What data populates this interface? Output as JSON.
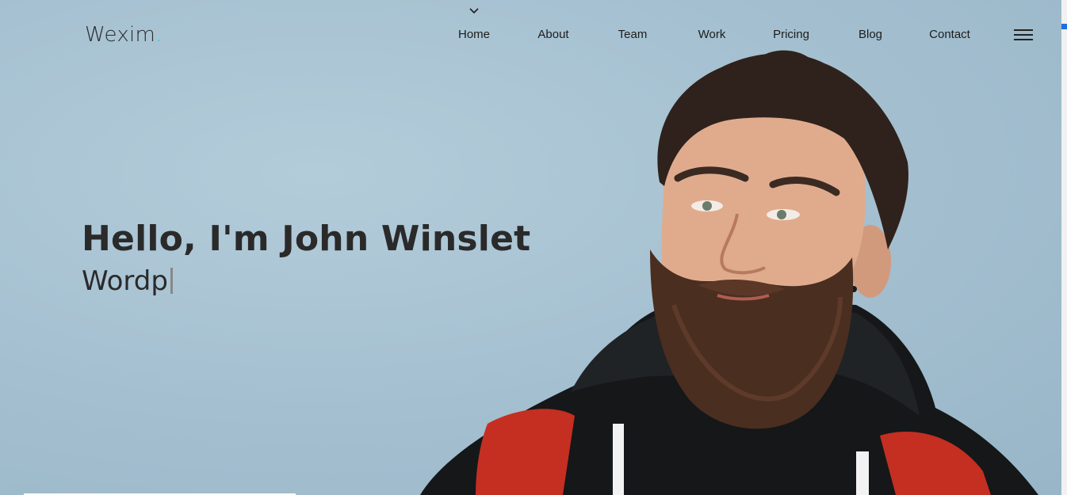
{
  "brand": {
    "name": "Wexim",
    "dot": ".",
    "accent": "#18c4e3"
  },
  "nav": {
    "items": [
      {
        "label": "Home",
        "active": true
      },
      {
        "label": "About"
      },
      {
        "label": "Team"
      },
      {
        "label": "Work"
      },
      {
        "label": "Pricing"
      },
      {
        "label": "Blog"
      },
      {
        "label": "Contact"
      }
    ],
    "active_indicator_icon": "chevron-down-icon",
    "menu_icon": "hamburger-menu-icon"
  },
  "hero": {
    "headline": "Hello, I'm John Winslet",
    "typed_text": "Wordp",
    "image": "portrait-bearded-man"
  },
  "colors": {
    "background": "#a9c4d3",
    "text": "#2a2a2a",
    "scroll_accent": "#1e6fe0"
  }
}
